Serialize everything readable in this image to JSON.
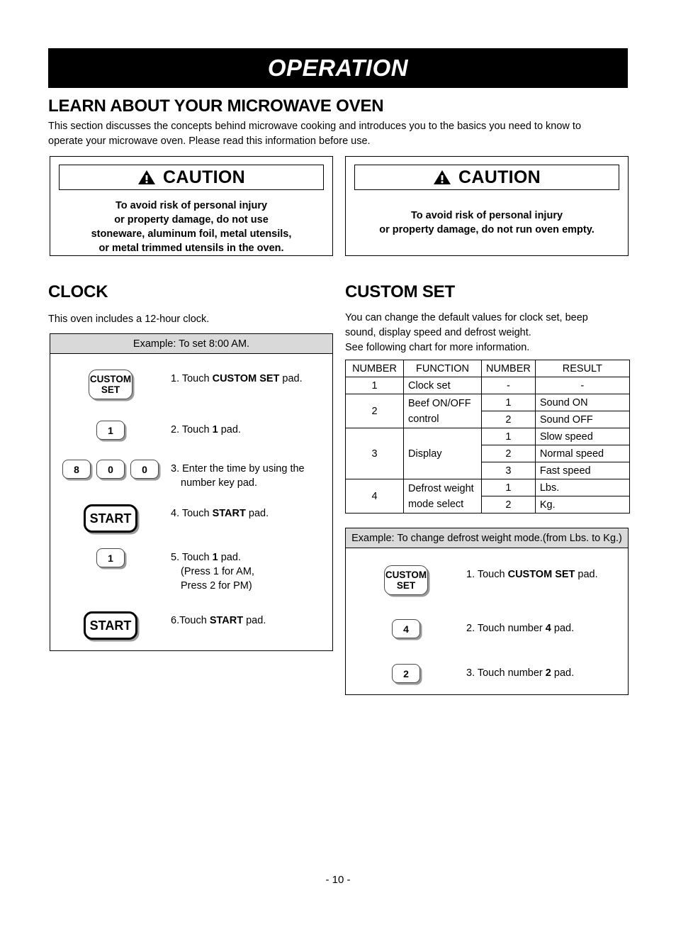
{
  "header": {
    "banner_title": "OPERATION"
  },
  "learn": {
    "heading": "LEARN ABOUT YOUR MICROWAVE OVEN",
    "paragraph": "This section discusses the concepts behind microwave cooking and introduces you to the basics you need to know to operate your microwave oven. Please read this information before use."
  },
  "caution_left": {
    "icon": "warning-triangle-icon",
    "title": "CAUTION",
    "line1": "To avoid risk of personal injury",
    "line2": "or property damage, do not use",
    "line3": "stoneware, aluminum foil, metal utensils,",
    "line4": "or metal trimmed utensils in the oven."
  },
  "caution_right": {
    "icon": "warning-triangle-icon",
    "title": "CAUTION",
    "line1": "To avoid risk of personal injury",
    "line2": "or property damage, do not run oven empty."
  },
  "clock": {
    "heading": "CLOCK",
    "intro": "This oven includes a 12-hour clock.",
    "example_title": "Example: To set 8:00 AM.",
    "steps": [
      {
        "keys": [
          {
            "type": "custom",
            "line1": "CUSTOM",
            "line2": "SET"
          }
        ],
        "num": "1. Touch ",
        "bold": "CUSTOM SET",
        "tail": " pad."
      },
      {
        "keys": [
          {
            "type": "num",
            "label": "1"
          }
        ],
        "num": "2. Touch ",
        "bold": "1",
        "tail": " pad."
      },
      {
        "keys": [
          {
            "type": "num",
            "label": "8"
          },
          {
            "type": "num",
            "label": "0"
          },
          {
            "type": "num",
            "label": "0"
          }
        ],
        "num": "3. Enter the time by using the",
        "bold": "",
        "tail": "",
        "sub": "number key pad."
      },
      {
        "keys": [
          {
            "type": "start",
            "label": "START"
          }
        ],
        "num": "4. Touch ",
        "bold": "START",
        "tail": " pad."
      },
      {
        "keys": [
          {
            "type": "num",
            "label": "1"
          }
        ],
        "num": "5. Touch ",
        "bold": "1",
        "tail": " pad.",
        "sub": "(Press 1 for AM,",
        "sub2": " Press 2 for PM)"
      },
      {
        "keys": [
          {
            "type": "start",
            "label": "START"
          }
        ],
        "num": "6.Touch ",
        "bold": "START",
        "tail": " pad."
      }
    ]
  },
  "custom_set": {
    "heading": "CUSTOM SET",
    "intro_line1": "You can change the default values for clock set, beep",
    "intro_line2": "sound, display speed and defrost weight.",
    "intro_line3": "See following chart for more information.",
    "table": {
      "headers": [
        "NUMBER",
        "FUNCTION",
        "NUMBER",
        "RESULT"
      ],
      "rows": [
        {
          "number": "1",
          "function": "Clock set",
          "sub": [
            {
              "number": "-",
              "result": "-",
              "center": true
            }
          ]
        },
        {
          "number": "2",
          "function": "Beef ON/OFF",
          "function2": "control",
          "sub": [
            {
              "number": "1",
              "result": "Sound ON"
            },
            {
              "number": "2",
              "result": "Sound OFF"
            }
          ]
        },
        {
          "number": "3",
          "function": "Display",
          "sub": [
            {
              "number": "1",
              "result": "Slow speed"
            },
            {
              "number": "2",
              "result": "Normal speed"
            },
            {
              "number": "3",
              "result": "Fast speed"
            }
          ]
        },
        {
          "number": "4",
          "function": "Defrost weight",
          "function2": "mode select",
          "sub": [
            {
              "number": "1",
              "result": "Lbs."
            },
            {
              "number": "2",
              "result": "Kg."
            }
          ]
        }
      ]
    },
    "example_title": "Example: To change defrost weight mode.(from Lbs. to Kg.)",
    "steps": [
      {
        "keys": [
          {
            "type": "custom",
            "line1": "CUSTOM",
            "line2": "SET"
          }
        ],
        "num": "1. Touch ",
        "bold": "CUSTOM SET",
        "tail": " pad."
      },
      {
        "keys": [
          {
            "type": "num",
            "label": "4"
          }
        ],
        "num": "2. Touch number ",
        "bold": "4",
        "tail": " pad."
      },
      {
        "keys": [
          {
            "type": "num",
            "label": "2"
          }
        ],
        "num": "3. Touch number ",
        "bold": "2",
        "tail": " pad."
      }
    ]
  },
  "footer": {
    "page_number": "- 10 -"
  }
}
